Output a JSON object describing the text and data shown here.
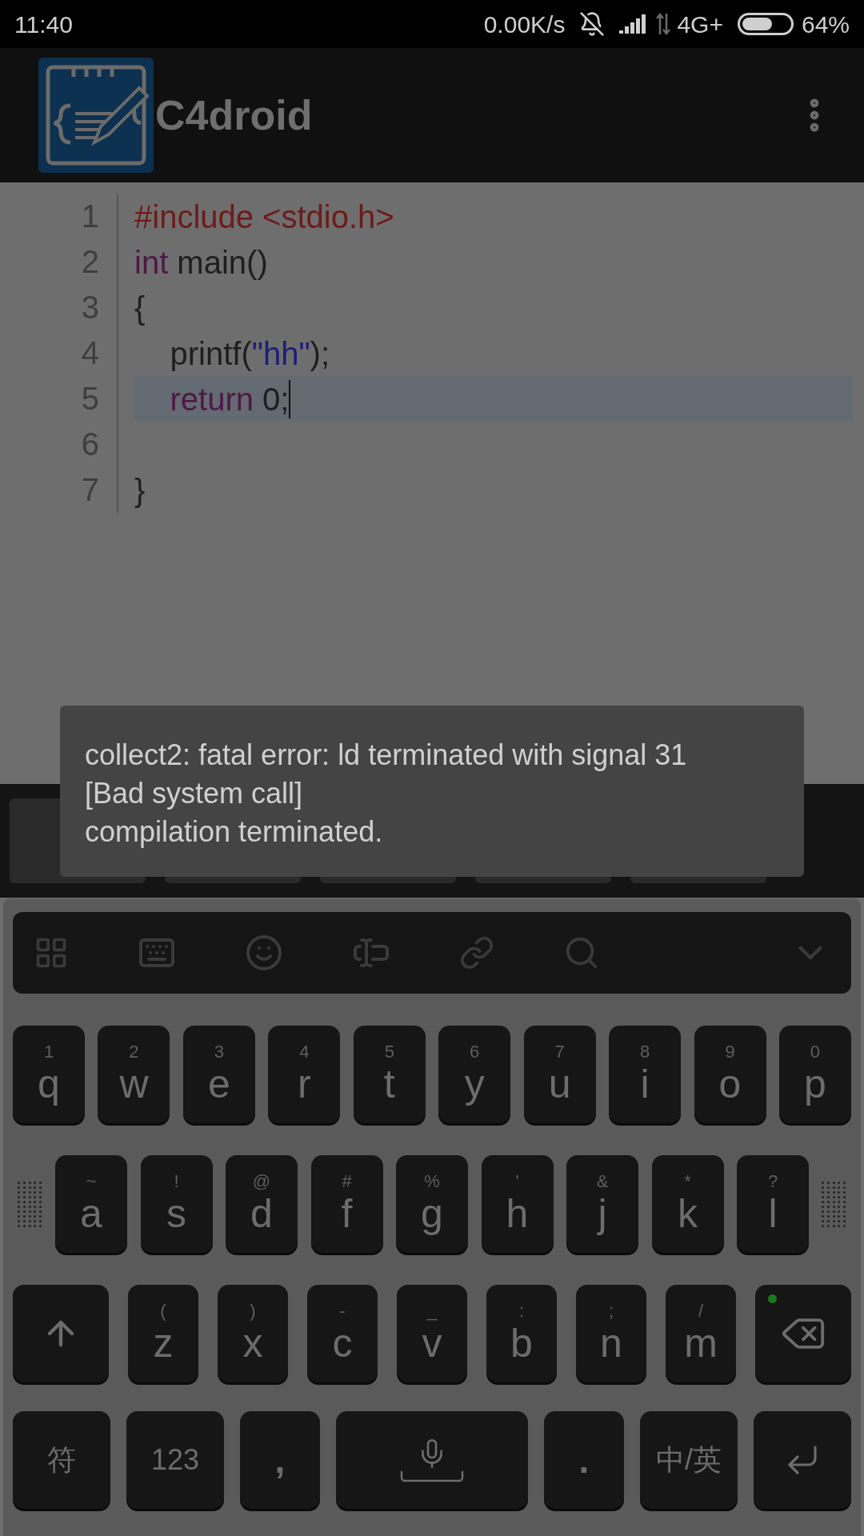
{
  "status_bar": {
    "time": "11:40",
    "net_speed": "0.00K/s",
    "network": "4G+",
    "battery": "64%"
  },
  "app_bar": {
    "title": "C4droid"
  },
  "editor": {
    "lines": [
      {
        "number": "1",
        "current": false,
        "tokens": [
          {
            "text": "#include <stdio.h>",
            "kind": "directive"
          }
        ]
      },
      {
        "number": "2",
        "current": false,
        "tokens": [
          {
            "text": "int",
            "kind": "keyword"
          },
          {
            "text": " main()",
            "kind": "plain"
          }
        ]
      },
      {
        "number": "3",
        "current": false,
        "tokens": [
          {
            "text": "{",
            "kind": "plain"
          }
        ]
      },
      {
        "number": "4",
        "current": false,
        "tokens": [
          {
            "text": "    printf(",
            "kind": "plain"
          },
          {
            "text": "\"hh\"",
            "kind": "string"
          },
          {
            "text": ");",
            "kind": "plain"
          }
        ]
      },
      {
        "number": "5",
        "current": true,
        "tokens": [
          {
            "text": "    return",
            "kind": "keyword"
          },
          {
            "text": " 0;",
            "kind": "plain"
          }
        ]
      },
      {
        "number": "6",
        "current": false
      },
      {
        "number": "7",
        "current": false,
        "tokens": [
          {
            "text": "}",
            "kind": "plain"
          }
        ]
      }
    ]
  },
  "toast": {
    "lines": [
      "collect2: fatal error: ld terminated with signal 31 [Bad system call]",
      "compilation terminated."
    ]
  },
  "keyboard": {
    "rows": [
      {
        "keys": [
          {
            "label": "q",
            "hint": "1"
          },
          {
            "label": "w",
            "hint": "2"
          },
          {
            "label": "e",
            "hint": "3"
          },
          {
            "label": "r",
            "hint": "4"
          },
          {
            "label": "t",
            "hint": "5"
          },
          {
            "label": "y",
            "hint": "6"
          },
          {
            "label": "u",
            "hint": "7"
          },
          {
            "label": "i",
            "hint": "8"
          },
          {
            "label": "o",
            "hint": "9"
          },
          {
            "label": "p",
            "hint": "0"
          }
        ]
      },
      {
        "keys": [
          {
            "label": "a",
            "hint": "~"
          },
          {
            "label": "s",
            "hint": "!"
          },
          {
            "label": "d",
            "hint": "@"
          },
          {
            "label": "f",
            "hint": "#"
          },
          {
            "label": "g",
            "hint": "%"
          },
          {
            "label": "h",
            "hint": "'"
          },
          {
            "label": "j",
            "hint": "&"
          },
          {
            "label": "k",
            "hint": "*"
          },
          {
            "label": "l",
            "hint": "?"
          }
        ]
      },
      {
        "keys": [
          {
            "kind": "shift"
          },
          {
            "label": "z",
            "hint": "("
          },
          {
            "label": "x",
            "hint": ")"
          },
          {
            "label": "c",
            "hint": "-"
          },
          {
            "label": "v",
            "hint": "_"
          },
          {
            "label": "b",
            "hint": ":"
          },
          {
            "label": "n",
            "hint": ";"
          },
          {
            "label": "m",
            "hint": "/"
          },
          {
            "kind": "backspace"
          }
        ]
      },
      {
        "keys": [
          {
            "kind": "symbol",
            "label": "符"
          },
          {
            "kind": "symbol",
            "label": "123"
          },
          {
            "kind": "punct",
            "label": ","
          },
          {
            "kind": "space"
          },
          {
            "kind": "punct",
            "label": "."
          },
          {
            "kind": "lang",
            "label": "中/英"
          },
          {
            "kind": "enter"
          }
        ]
      }
    ]
  }
}
